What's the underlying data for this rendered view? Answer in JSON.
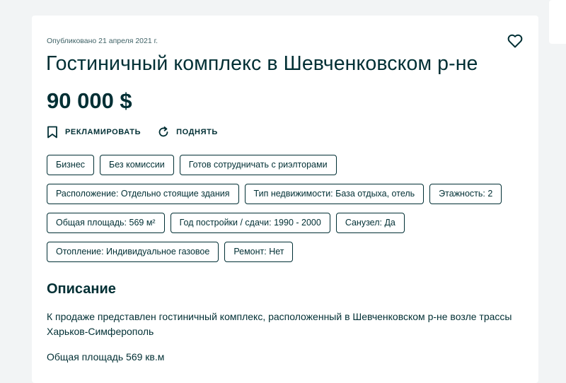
{
  "listing": {
    "published": "Опубликовано 21 апреля 2021 г.",
    "title": "Гостиничный комплекс в Шевченковском р-не",
    "price": "90 000 $"
  },
  "actions": {
    "promote_label": "РЕКЛАМИРОВАТЬ",
    "promote_icon": "bookmark-icon",
    "raise_label": "ПОДНЯТЬ",
    "raise_icon": "refresh-icon",
    "favorite_icon": "heart-icon"
  },
  "tags": {
    "row1": [
      "Бизнес",
      "Без комиссии",
      "Готов сотрудничать с риэлторами"
    ],
    "row2": [
      "Расположение: Отдельно стоящие здания",
      "Тип недвижимости: База отдыха, отель",
      "Этажность: 2"
    ],
    "row3": [
      "Общая площадь: 569 м²",
      "Год постройки / сдачи: 1990 - 2000",
      "Санузел: Да"
    ],
    "row4": [
      "Отопление: Индивидуальное газовое",
      "Ремонт: Нет"
    ]
  },
  "description": {
    "heading": "Описание",
    "paragraph1": "К продаже представлен гостиничный комплекс, расположенный в Шевченковском р-не возле трассы Харьков-Симферополь",
    "paragraph2": "Общая площадь 569 кв.м"
  },
  "colors": {
    "text": "#002f34",
    "background": "#f2f4f5",
    "card": "#ffffff"
  }
}
